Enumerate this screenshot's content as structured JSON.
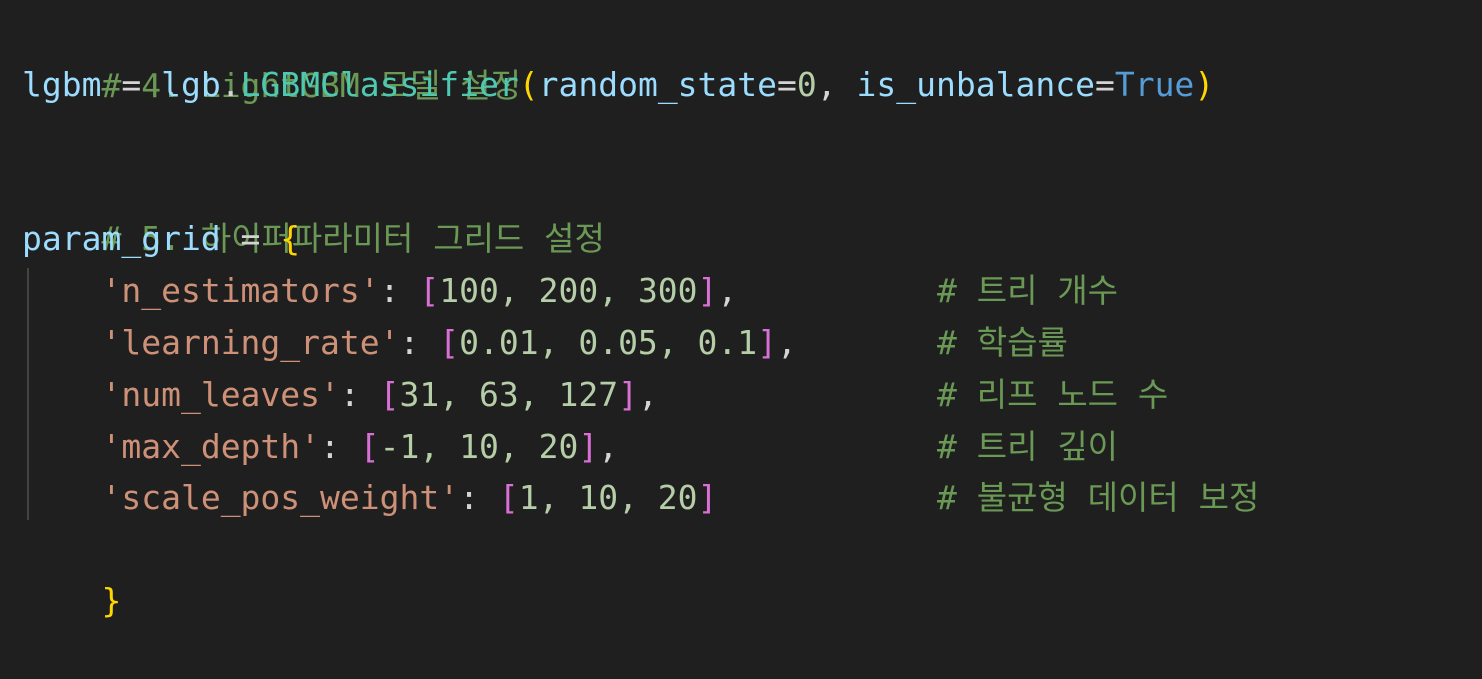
{
  "code": {
    "line1_comment": "# 4. LightGBM 모델 설정",
    "line2": {
      "var": "lgbm",
      "assign": " = ",
      "module": "lgb",
      "dot": ".",
      "cls": "LGBMClassifier",
      "open_paren": "(",
      "arg1_name": "random_state",
      "eq1": "=",
      "arg1_val": "0",
      "comma": ", ",
      "arg2_name": "is_unbalance",
      "eq2": "=",
      "arg2_val": "True",
      "close_paren": ")"
    },
    "line4_comment": "# 5. 하이퍼파라미터 그리드 설정",
    "line5": {
      "var": "param_grid",
      "assign": " = ",
      "open_brace": "{"
    },
    "entries": [
      {
        "key": "'n_estimators'",
        "colon": ": ",
        "open": "[",
        "values": "100, 200, 300",
        "close": "]",
        "trail": ",",
        "comment": "# 트리 개수"
      },
      {
        "key": "'learning_rate'",
        "colon": ": ",
        "open": "[",
        "values": "0.01, 0.05, 0.1",
        "close": "]",
        "trail": ",",
        "comment": "# 학습률"
      },
      {
        "key": "'num_leaves'",
        "colon": ": ",
        "open": "[",
        "values": "31, 63, 127",
        "close": "]",
        "trail": ",",
        "comment": "# 리프 노드 수"
      },
      {
        "key": "'max_depth'",
        "colon": ": ",
        "open": "[",
        "values": "-1, 10, 20",
        "close": "]",
        "trail": ",",
        "comment": "# 트리 깊이"
      },
      {
        "key": "'scale_pos_weight'",
        "colon": ": ",
        "open": "[",
        "values": "1, 10, 20",
        "close": "]",
        "trail": "",
        "comment": "# 불균형 데이터 보정"
      }
    ],
    "close_brace": "}"
  },
  "colors": {
    "background": "#1f1f1f",
    "comment": "#6a9955",
    "variable": "#9cdcfe",
    "function": "#4ec9b0",
    "constant": "#569cd6",
    "number": "#b5cea8",
    "string": "#ce9178",
    "bracket_level1": "#ffd700",
    "bracket_level2": "#da70d6"
  }
}
